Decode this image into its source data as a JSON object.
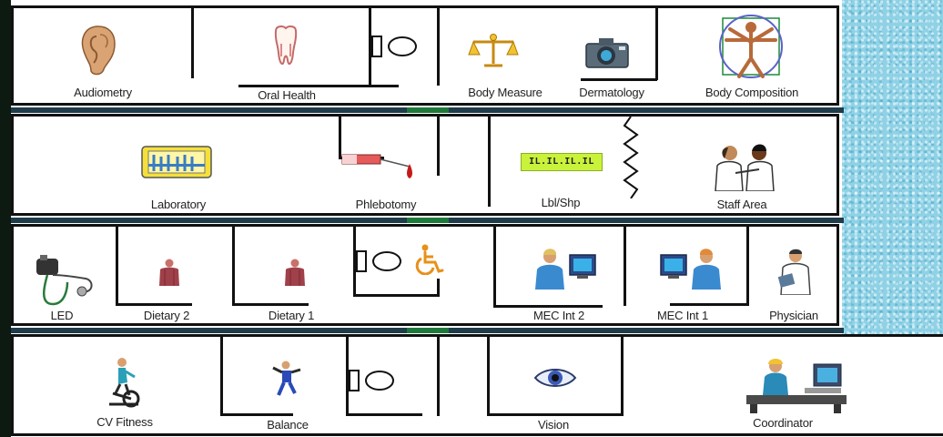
{
  "colors": {
    "wall": "#111111",
    "floor": "#ffffff",
    "texture": "#8fd2e6",
    "divider": "#1f3c4b",
    "divider_accent": "#1d7a3a"
  },
  "rows": [
    {
      "rooms": [
        {
          "label": "Audiometry",
          "icon": "ear-icon"
        },
        {
          "label": "Oral Health",
          "icon": "tooth-icon"
        },
        {
          "label": "",
          "icon": "toilet-icon"
        },
        {
          "label": "Body Measure",
          "icon": "scale-icon"
        },
        {
          "label": "Dermatology",
          "icon": "camera-icon"
        },
        {
          "label": "Body Composition",
          "icon": "vitruvian-man-icon"
        }
      ]
    },
    {
      "rooms": [
        {
          "label": "Laboratory",
          "icon": "lab-equipment-icon"
        },
        {
          "label": "Phlebotomy",
          "icon": "syringe-icon"
        },
        {
          "label": "Lbl/Shp",
          "icon": "label-printer-icon",
          "display": "IL.IL.IL.IL"
        },
        {
          "label": "Staff Area",
          "icon": "staff-people-icon"
        }
      ]
    },
    {
      "rooms": [
        {
          "label": "LED",
          "icon": "stethoscope-icon"
        },
        {
          "label": "Dietary 2",
          "icon": "torso-icon"
        },
        {
          "label": "Dietary 1",
          "icon": "torso-icon"
        },
        {
          "label": "",
          "icon": "toilet-icon"
        },
        {
          "label": "",
          "icon": "wheelchair-icon"
        },
        {
          "label": "MEC Int 2",
          "icon": "computer-interviewer-icon"
        },
        {
          "label": "MEC Int 1",
          "icon": "computer-interviewer-icon"
        },
        {
          "label": "Physician",
          "icon": "doctor-icon"
        }
      ]
    },
    {
      "rooms": [
        {
          "label": "CV Fitness",
          "icon": "exercise-bike-icon"
        },
        {
          "label": "Balance",
          "icon": "balance-person-icon"
        },
        {
          "label": "",
          "icon": "toilet-icon"
        },
        {
          "label": "Vision",
          "icon": "eye-icon"
        },
        {
          "label": "Coordinator",
          "icon": "coordinator-desk-icon"
        }
      ]
    }
  ]
}
